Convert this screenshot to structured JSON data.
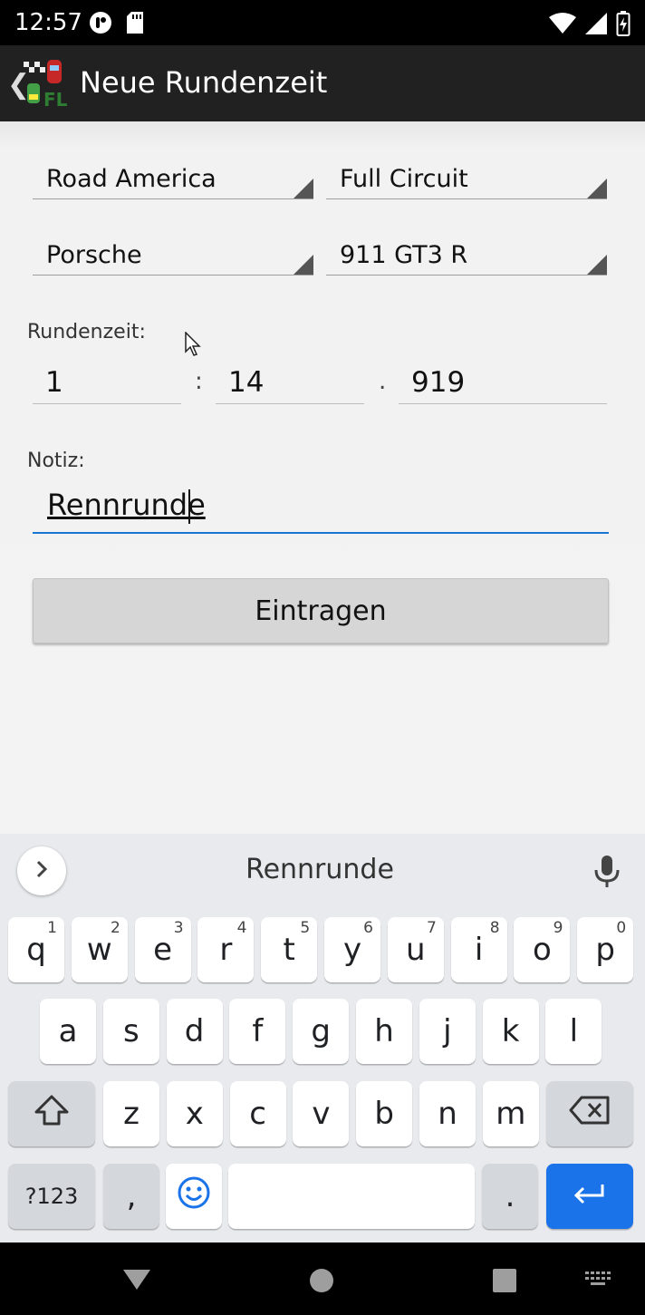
{
  "status_bar": {
    "time": "12:57",
    "left_icons": [
      "notification-icon",
      "sd-card-icon"
    ],
    "right_icons": [
      "wifi-icon",
      "signal-icon",
      "battery-icon"
    ]
  },
  "app_bar": {
    "title": "Neue Rundenzeit",
    "logo_text": "FL"
  },
  "form": {
    "track": "Road America",
    "layout": "Full Circuit",
    "manufacturer": "Porsche",
    "car": "911 GT3 R",
    "laptime_label": "Rundenzeit:",
    "minutes": "1",
    "seconds": "14",
    "milliseconds": "919",
    "sep_colon": ":",
    "sep_dot": ".",
    "note_label": "Notiz:",
    "note_value": "Rennrunde",
    "submit_label": "Eintragen"
  },
  "keyboard": {
    "suggestion": "Rennrunde",
    "row1": [
      {
        "k": "q",
        "h": "1"
      },
      {
        "k": "w",
        "h": "2"
      },
      {
        "k": "e",
        "h": "3"
      },
      {
        "k": "r",
        "h": "4"
      },
      {
        "k": "t",
        "h": "5"
      },
      {
        "k": "y",
        "h": "6"
      },
      {
        "k": "u",
        "h": "7"
      },
      {
        "k": "i",
        "h": "8"
      },
      {
        "k": "o",
        "h": "9"
      },
      {
        "k": "p",
        "h": "0"
      }
    ],
    "row2": [
      "a",
      "s",
      "d",
      "f",
      "g",
      "h",
      "j",
      "k",
      "l"
    ],
    "row3": [
      "z",
      "x",
      "c",
      "v",
      "b",
      "n",
      "m"
    ],
    "symbols_label": "?123",
    "comma_label": ",",
    "period_label": "."
  },
  "colors": {
    "accent": "#1976d2",
    "enter_key": "#1a73e8",
    "app_bar": "#212121"
  }
}
